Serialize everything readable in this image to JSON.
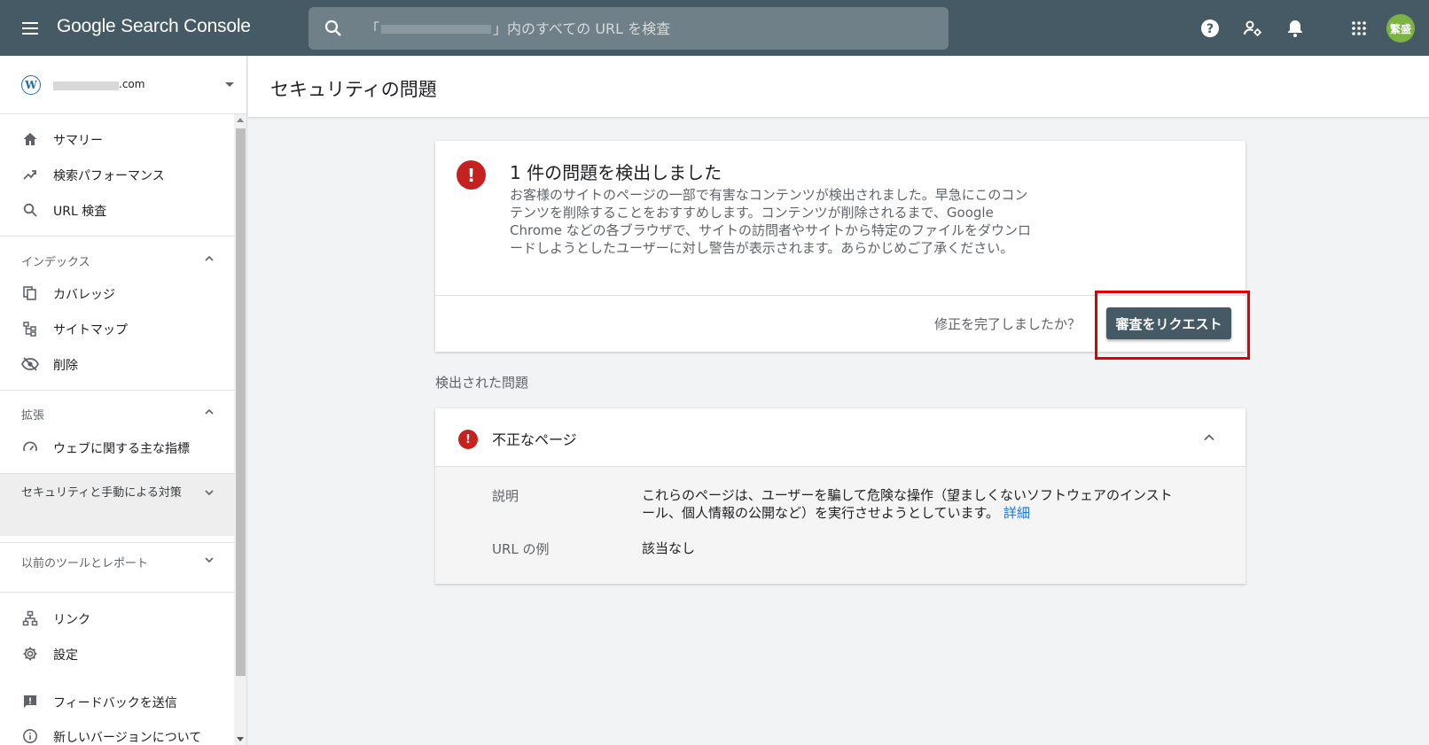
{
  "topbar": {
    "app_title": "Google Search Console",
    "search_placeholder": "「　　　　　　　　」内のすべての URL を検査",
    "avatar_text": "繁盛",
    "icons": [
      "menu-icon",
      "search-icon",
      "help-icon",
      "manage-users-icon",
      "notifications-icon",
      "apps-icon"
    ]
  },
  "sidebar": {
    "property_suffix": ".com",
    "items_top": [
      {
        "label": "サマリー",
        "icon": "home-icon"
      },
      {
        "label": "検索パフォーマンス",
        "icon": "trending-up-icon"
      },
      {
        "label": "URL 検査",
        "icon": "search-icon"
      }
    ],
    "index_section": "インデックス",
    "items_index": [
      {
        "label": "カバレッジ",
        "icon": "copy-icon"
      },
      {
        "label": "サイトマップ",
        "icon": "sitemap-icon"
      },
      {
        "label": "削除",
        "icon": "visibility-off-icon"
      }
    ],
    "enhance_section": "拡張",
    "items_enhance": [
      {
        "label": "ウェブに関する主な指標",
        "icon": "speed-icon"
      }
    ],
    "security_section": "セキュリティと手動による対策",
    "legacy_section": "以前のツールとレポート",
    "items_bottom": [
      {
        "label": "リンク",
        "icon": "links-icon"
      },
      {
        "label": "設定",
        "icon": "settings-icon"
      },
      {
        "label": "フィードバックを送信",
        "icon": "feedback-icon"
      },
      {
        "label": "新しいバージョンについて",
        "icon": "info-icon"
      }
    ]
  },
  "main": {
    "page_title": "セキュリティの問題",
    "alert": {
      "icon_text": "!",
      "title": "1 件の問題を検出しました",
      "description": "お客様のサイトのページの一部で有害なコンテンツが検出されました。早急にこのコンテンツを削除することをおすすめします。コンテンツが削除されるまで、Google Chrome などの各ブラウザで、サイトの訪問者やサイトから特定のファイルをダウンロードしようとしたユーザーに対し警告が表示されます。あらかじめご了承ください。",
      "fix_question": "修正を完了しましたか？",
      "request_button": "審査をリクエスト"
    },
    "issues_label": "検出された問題",
    "issue": {
      "icon_text": "!",
      "title": "不正なページ",
      "desc_label": "説明",
      "desc_value": "これらのページは、ユーザーを騙して危険な操作（望ましくないソフトウェアのインストール、個人情報の公開など）を実行させようとしています。",
      "detail_link": "詳細",
      "url_label": "URL の例",
      "url_value": "該当なし"
    }
  },
  "colors": {
    "topbar": "#455a64",
    "error": "#c5221f",
    "button": "#455a64",
    "link": "#1a73e8",
    "highlight": "#e00000",
    "avatar": "#7cb342"
  }
}
